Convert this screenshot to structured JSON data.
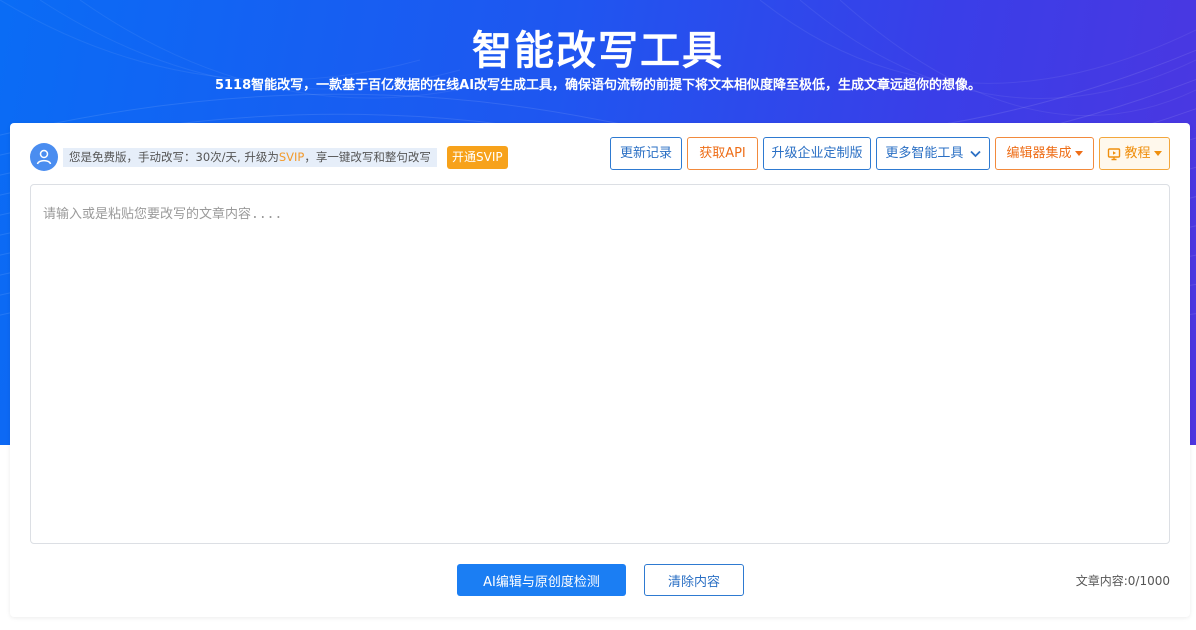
{
  "hero": {
    "title": "智能改写工具",
    "subtitle": "5118智能改写，一款基于百亿数据的在线AI改写生成工具，确保语句流畅的前提下将文本相似度降至极低，生成文章远超你的想像。"
  },
  "user": {
    "avatar_icon": "user-icon",
    "notice_prefix": "您是免费版，手动改写：30次/天, 升级为",
    "notice_highlight": "SVIP",
    "notice_suffix": "，享一键改写和整句改写",
    "upgrade_button": "开通SVIP"
  },
  "toolbar": {
    "changelog": "更新记录",
    "get_api": "获取API",
    "enterprise": "升级企业定制版",
    "more_tools": "更多智能工具",
    "editor_integration": "编辑器集成",
    "tutorial": "教程"
  },
  "editor": {
    "placeholder": "请输入或是粘贴您要改写的文章内容....",
    "value": ""
  },
  "actions": {
    "primary": "AI编辑与原创度检测",
    "clear": "清除内容"
  },
  "counter": {
    "label": "文章内容:",
    "value": "0/1000"
  },
  "colors": {
    "brand_blue": "#1b7ef3",
    "accent_orange": "#ee6e18",
    "svip_amber": "#f7a21b"
  }
}
